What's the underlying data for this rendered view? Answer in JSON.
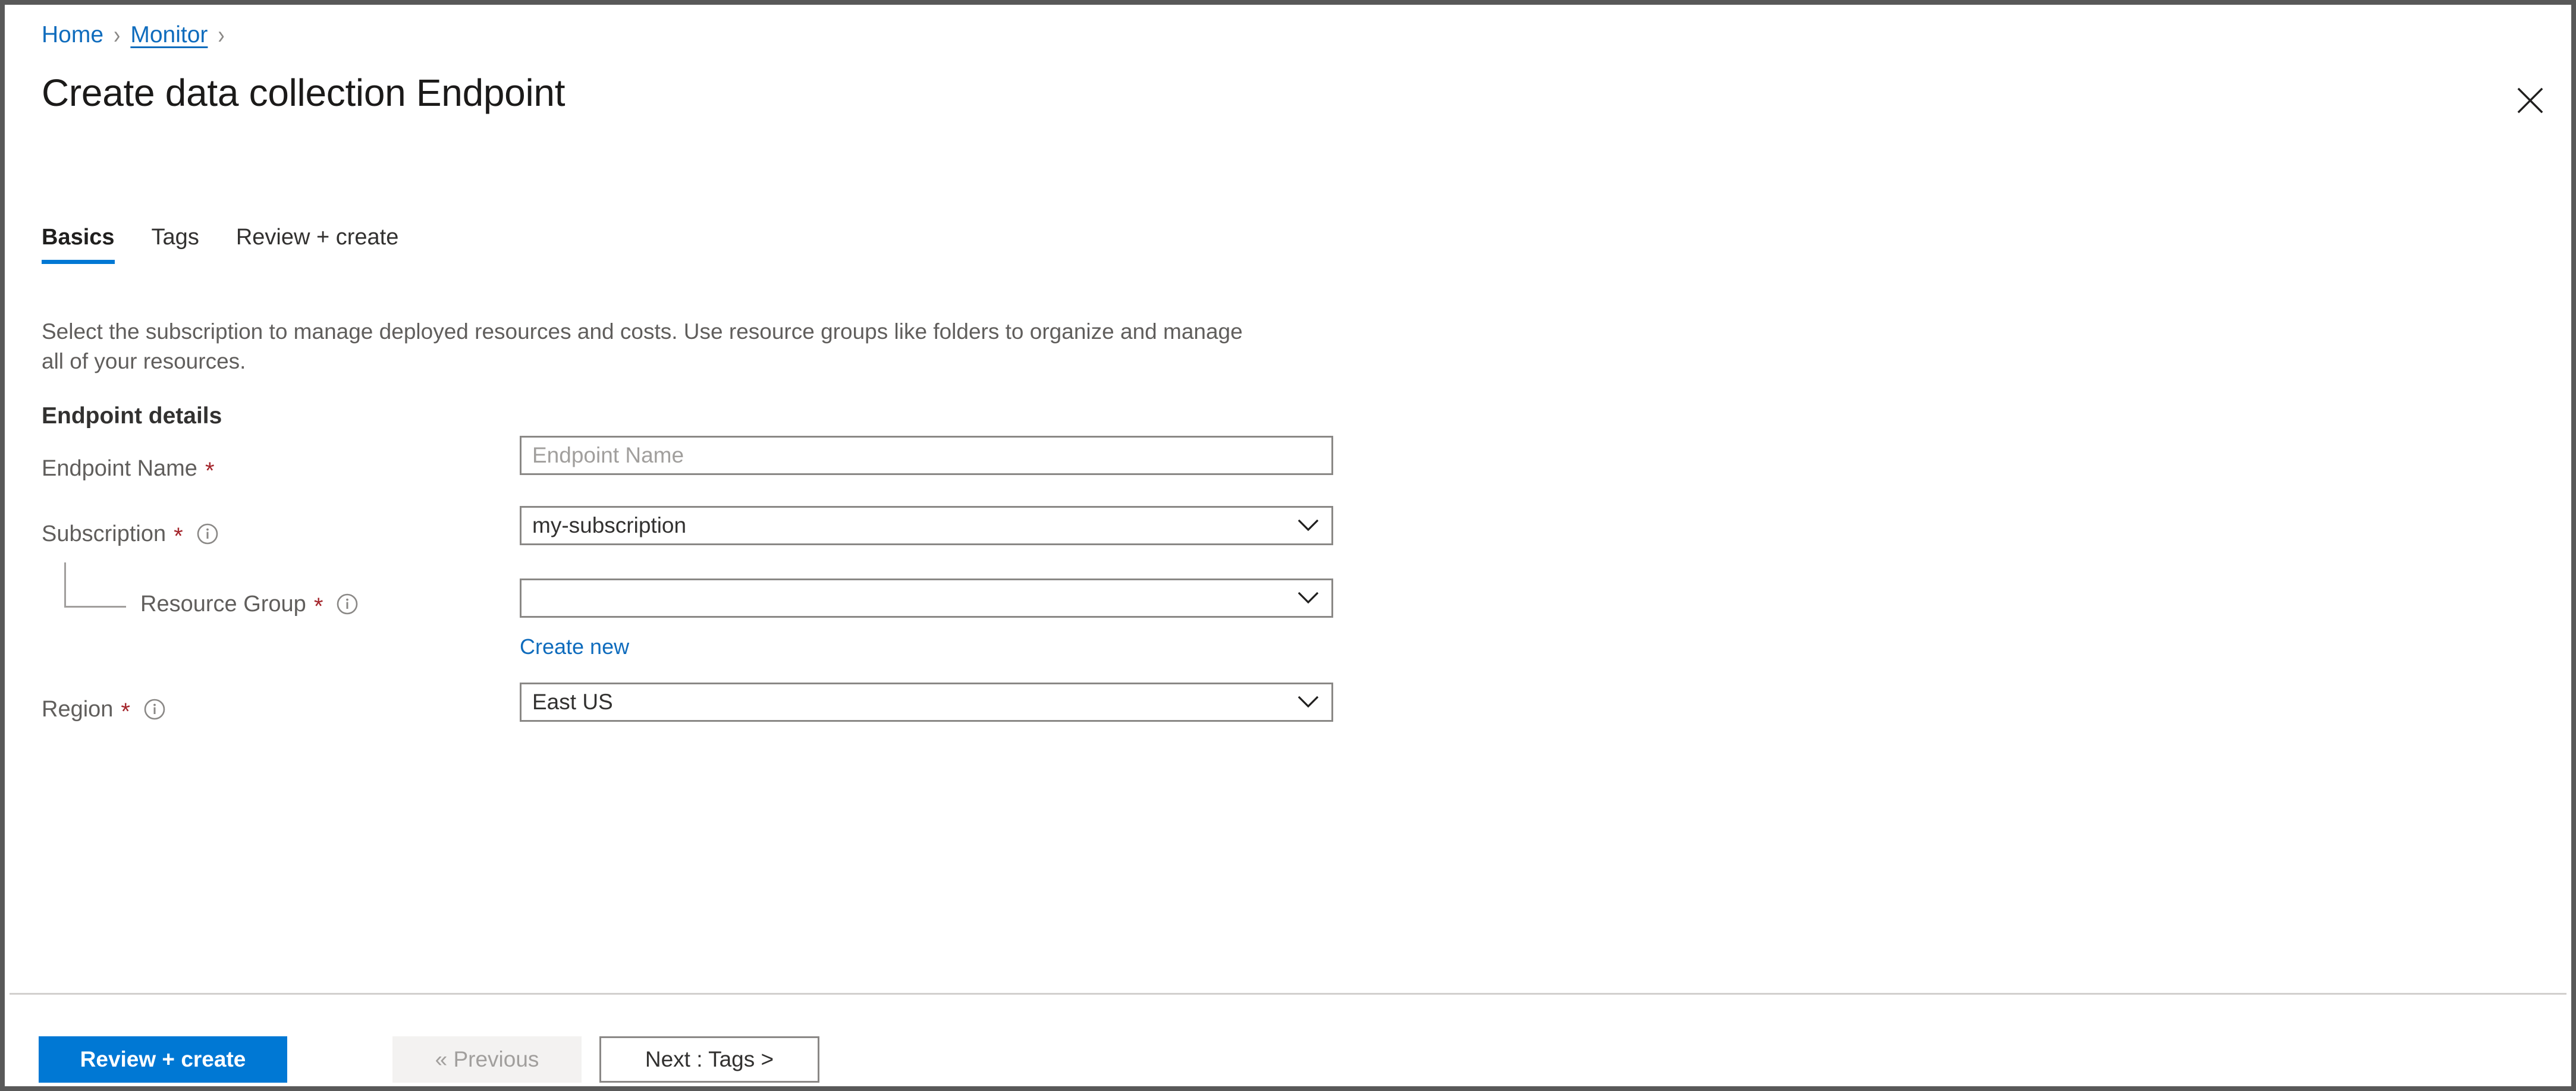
{
  "breadcrumb": {
    "items": [
      {
        "label": "Home",
        "underlined": false
      },
      {
        "label": "Monitor",
        "underlined": true
      }
    ],
    "separator": "›"
  },
  "header": {
    "title": "Create data collection Endpoint",
    "close_icon": "close-icon"
  },
  "tabs": [
    {
      "label": "Basics",
      "active": true
    },
    {
      "label": "Tags",
      "active": false
    },
    {
      "label": "Review + create",
      "active": false
    }
  ],
  "main": {
    "description": "Select the subscription to manage deployed resources and costs. Use resource groups like folders to organize and manage all of your resources.",
    "section_title": "Endpoint details",
    "required_marker": "*",
    "fields": {
      "endpoint_name": {
        "label": "Endpoint Name",
        "required": true,
        "has_info": false,
        "placeholder": "Endpoint Name",
        "value": ""
      },
      "subscription": {
        "label": "Subscription",
        "required": true,
        "has_info": true,
        "value": "my-subscription"
      },
      "resource_group": {
        "label": "Resource Group",
        "required": true,
        "has_info": true,
        "value": "",
        "create_new_label": "Create new"
      },
      "region": {
        "label": "Region",
        "required": true,
        "has_info": true,
        "value": "East US"
      }
    }
  },
  "footer": {
    "review_create_label": "Review + create",
    "previous_label": "« Previous",
    "next_label": "Next : Tags >"
  },
  "colors": {
    "accent": "#0078d4",
    "link": "#0f6cbd",
    "required": "#a4262c",
    "border": "#8a8886",
    "text": "#323130",
    "muted": "#605e5c"
  }
}
